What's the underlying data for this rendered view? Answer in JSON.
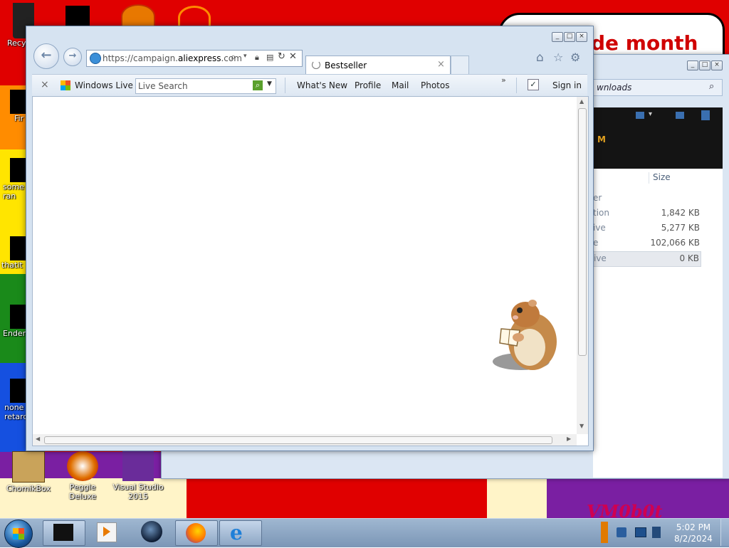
{
  "desktop": {
    "icons": [
      {
        "label": "ChomikBox"
      },
      {
        "label": "Peggle Deluxe"
      },
      {
        "label": "Visual Studio 2015"
      }
    ],
    "side_icons": [
      {
        "label": "Recy"
      },
      {
        "label": "Fir"
      },
      {
        "label": "some ran"
      },
      {
        "label": "thatit"
      },
      {
        "label": "Ender"
      },
      {
        "label": "none retarc"
      }
    ],
    "wallpaper_text": "de month",
    "taskbar_graffiti": "VM0b0t"
  },
  "explorer": {
    "search_label": "wnloads",
    "toolbar_text": "M",
    "column_header": "Size",
    "rows": [
      {
        "name": "er",
        "size": ""
      },
      {
        "name": "tion",
        "size": "1,842 KB"
      },
      {
        "name": "ive",
        "size": "5,277 KB"
      },
      {
        "name": "e",
        "size": "102,066 KB"
      },
      {
        "name": "ive",
        "size": "0 KB"
      }
    ]
  },
  "browser": {
    "address_prefix": "https://campaign.",
    "address_domain": "aliexpress",
    "address_suffix": ".com",
    "tab_title": "Bestseller",
    "command_bar": {
      "windows_live": "Windows Live",
      "search_placeholder": "Live Search",
      "links": [
        "What's New",
        "Profile",
        "Mail",
        "Photos"
      ],
      "overflow": "»",
      "sign_in": "Sign in"
    }
  },
  "taskbar": {
    "time": "5:02 PM",
    "date": "8/2/2024"
  },
  "colors": {
    "wallpaper_red": "#e00000",
    "wallpaper_purple": "#7a1fa2",
    "taskbar": "#8aa4c4",
    "window_frame": "#d6e3f1"
  }
}
